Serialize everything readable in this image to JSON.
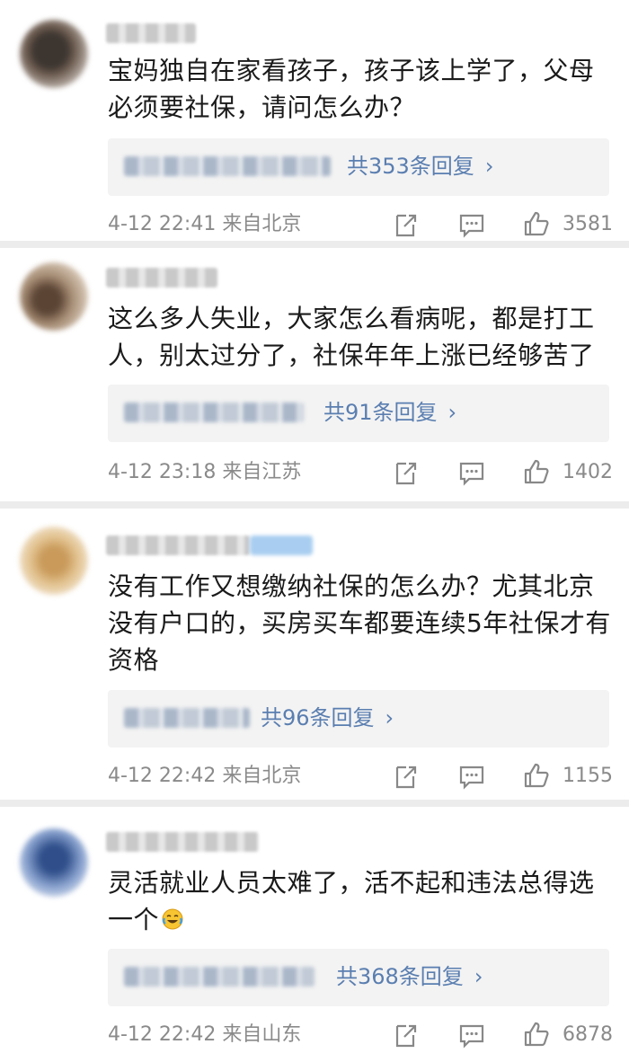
{
  "colors": {
    "link": "#5a7eb0",
    "meta": "#8a8a8a",
    "text": "#1a1a1a",
    "separator": "#ececec"
  },
  "comments": [
    {
      "text": "宝妈独自在家看孩子，孩子该上学了，父母必须要社保，请问怎么办？",
      "reply_label": "共353条回复",
      "time": "4-12 22:41",
      "location": "来自北京",
      "likes": "3581"
    },
    {
      "text": "这么多人失业，大家怎么看病呢，都是打工人，别太过分了，社保年年上涨已经够苦了",
      "reply_label": "共91条回复",
      "time": "4-12 23:18",
      "location": "来自江苏",
      "likes": "1402"
    },
    {
      "text": "没有工作又想缴纳社保的怎么办？尤其北京没有户口的，买房买车都要连续5年社保才有资格",
      "reply_label": "共96条回复",
      "time": "4-12 22:42",
      "location": "来自北京",
      "likes": "1155"
    },
    {
      "text": "灵活就业人员太难了，活不起和违法总得选一个",
      "emoji": "laugh-cry-emoji",
      "reply_label": "共368条回复",
      "time": "4-12 22:42",
      "location": "来自山东",
      "likes": "6878"
    }
  ],
  "icons": {
    "share": "share-icon",
    "comment": "comment-icon",
    "like": "thumbs-up-icon",
    "reply_chevron": "›"
  }
}
